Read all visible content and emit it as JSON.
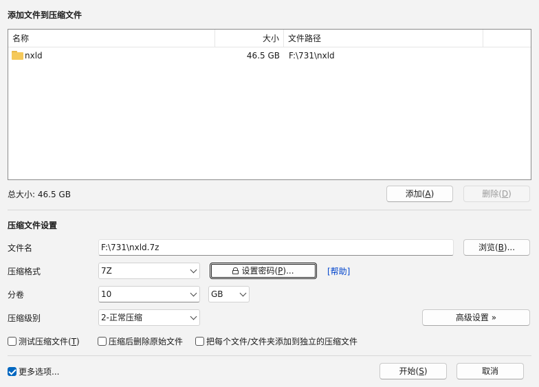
{
  "add_section": {
    "title": "添加文件到压缩文件",
    "columns": {
      "name": "名称",
      "size": "大小",
      "path": "文件路径"
    },
    "files": [
      {
        "name": "nxld",
        "size": "46.5 GB",
        "path": "F:\\731\\nxld",
        "icon": "folder-icon"
      }
    ],
    "total_size": "总大小: 46.5 GB",
    "add_button": {
      "label": "添加(",
      "key": "A",
      "suffix": ")"
    },
    "delete_button": {
      "label": "删除(",
      "key": "D",
      "suffix": ")"
    }
  },
  "settings": {
    "title": "压缩文件设置",
    "filename_label": "文件名",
    "filename_value": "F:\\731\\nxld.7z",
    "browse_button": {
      "label": "浏览(",
      "key": "B",
      "suffix": ")..."
    },
    "format_label": "压缩格式",
    "format_value": "7Z",
    "password_button": {
      "label": "设置密码(",
      "key": "P",
      "suffix": ")..."
    },
    "help_link": "[帮助]",
    "volume_label": "分卷",
    "volume_value": "10",
    "volume_unit": "GB",
    "level_label": "压缩级别",
    "level_value": "2-正常压缩",
    "advanced_button": "高级设置 »",
    "options": {
      "test": {
        "label": "测试压缩文件(",
        "key": "T",
        "suffix": ")",
        "checked": false
      },
      "delete_after": {
        "label": "压缩后删除原始文件",
        "checked": false
      },
      "separate": {
        "label": "把每个文件/文件夹添加到独立的压缩文件",
        "checked": false
      }
    }
  },
  "footer": {
    "more_options": {
      "label": "更多选项...",
      "checked": true
    },
    "start_button": {
      "label": "开始(",
      "key": "S",
      "suffix": ")"
    },
    "cancel_button": "取消"
  },
  "colors": {
    "accent": "#0067c0",
    "link": "#0044cc",
    "folder": "#f5c95a"
  }
}
